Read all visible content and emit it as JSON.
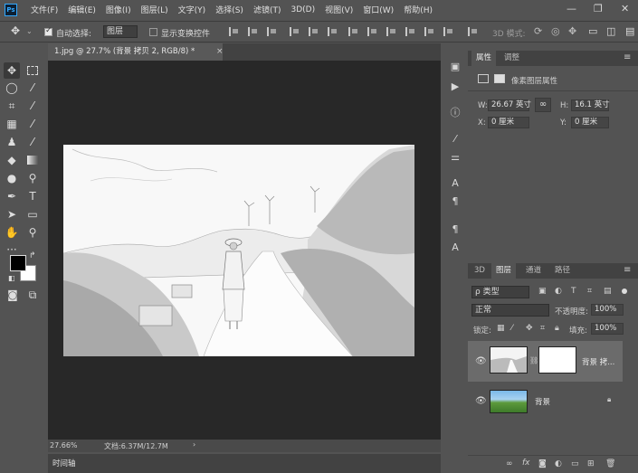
{
  "menubar": {
    "logo": "Ps",
    "items": [
      "文件(F)",
      "编辑(E)",
      "图像(I)",
      "图层(L)",
      "文字(Y)",
      "选择(S)",
      "滤镜(T)",
      "3D(D)",
      "视图(V)",
      "窗口(W)",
      "帮助(H)"
    ],
    "minimize": "—",
    "maximize": "❐",
    "close": "✕"
  },
  "options": {
    "auto_select_label": "自动选择:",
    "auto_select_checked": true,
    "auto_select_target": "图层",
    "show_transform_label": "显示变换控件",
    "show_transform_checked": false,
    "mode_3d_label": "3D 模式:"
  },
  "document": {
    "tab_title": "1.jpg @ 27.7% (背景 拷贝 2, RGB/8) *",
    "close": "×"
  },
  "status": {
    "zoom": "27.66%",
    "doc_size": "文档:6.37M/12.7M",
    "arrow": "›"
  },
  "timeline": {
    "label": "时间轴"
  },
  "properties": {
    "tabs": [
      "属性",
      "调整"
    ],
    "header": "像素图层属性",
    "w_label": "W:",
    "w_value": "26.67 英寸",
    "h_label": "H:",
    "h_value": "16.1 英寸",
    "x_label": "X:",
    "x_value": "0 厘米",
    "y_label": "Y:",
    "y_value": "0 厘米",
    "link_icon": "∞"
  },
  "layers": {
    "tabs": [
      "3D",
      "图层",
      "通道",
      "路径"
    ],
    "filter_kind": "ρ 类型",
    "blend_mode": "正常",
    "opacity_label": "不透明度:",
    "opacity_value": "100%",
    "lock_label": "锁定:",
    "fill_label": "填充:",
    "fill_value": "100%",
    "items": [
      {
        "name": "背景 拷...",
        "visible": true,
        "selected": true
      },
      {
        "name": "背景",
        "visible": true,
        "locked": true
      }
    ],
    "footer_icons": [
      "link-icon",
      "fx-icon",
      "mask-icon",
      "adjustment-icon",
      "group-icon",
      "new-layer-icon",
      "trash-icon"
    ]
  },
  "colors": {
    "app_bg": "#535353",
    "panel_dark": "#424242",
    "canvas_bg": "#282828",
    "selected_layer": "#6b6b6b",
    "ps_blue": "#31a8ff"
  }
}
